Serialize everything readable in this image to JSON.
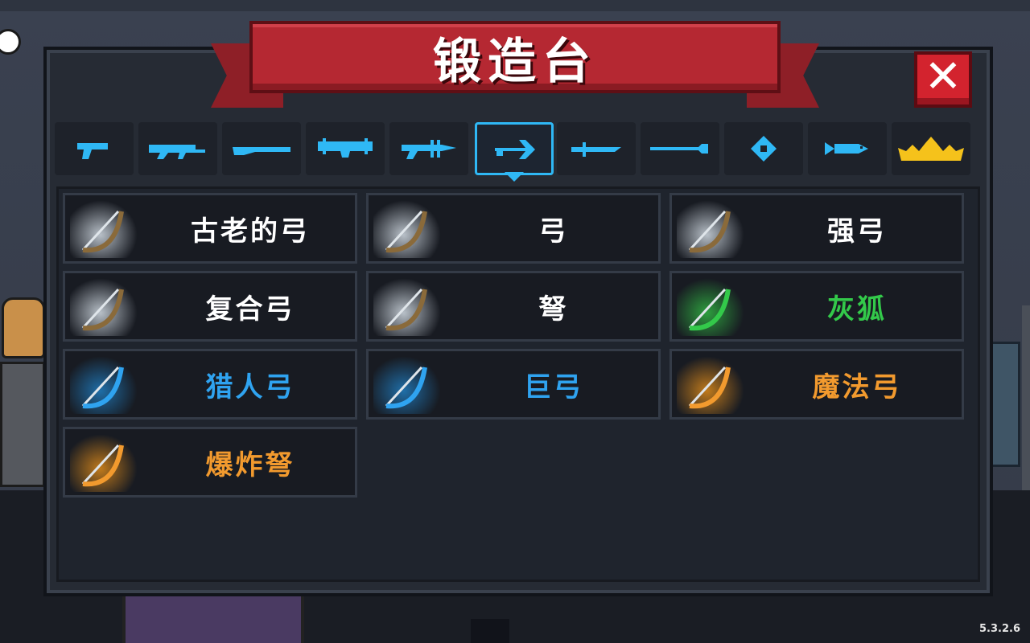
{
  "window": {
    "title": "锻造台",
    "close_symbol": "✕"
  },
  "tabs": [
    {
      "icon": "pistol-icon",
      "active": false
    },
    {
      "icon": "assault-rifle-icon",
      "active": false
    },
    {
      "icon": "shotgun-icon",
      "active": false
    },
    {
      "icon": "rocket-launcher-icon",
      "active": false
    },
    {
      "icon": "laser-gun-icon",
      "active": false
    },
    {
      "icon": "bow-arrow-icon",
      "active": true
    },
    {
      "icon": "sword-icon",
      "active": false
    },
    {
      "icon": "spear-icon",
      "active": false
    },
    {
      "icon": "shuriken-icon",
      "active": false
    },
    {
      "icon": "fish-icon",
      "active": false
    },
    {
      "icon": "crown-icon",
      "active": false
    }
  ],
  "items": [
    {
      "name": "古老的弓",
      "color": "#ffffff",
      "glow": "#b8c0c8"
    },
    {
      "name": "弓",
      "color": "#ffffff",
      "glow": "#b8c0c8"
    },
    {
      "name": "强弓",
      "color": "#ffffff",
      "glow": "#b8c0c8"
    },
    {
      "name": "复合弓",
      "color": "#ffffff",
      "glow": "#b8c0c8"
    },
    {
      "name": "弩",
      "color": "#ffffff",
      "glow": "#b8c0c8"
    },
    {
      "name": "灰狐",
      "color": "#33c94a",
      "glow": "#2d9e3e"
    },
    {
      "name": "猎人弓",
      "color": "#2fa3f0",
      "glow": "#1f6ea8"
    },
    {
      "name": "巨弓",
      "color": "#2fa3f0",
      "glow": "#1f6ea8"
    },
    {
      "name": "魔法弓",
      "color": "#f29a2e",
      "glow": "#c07a1c"
    },
    {
      "name": "爆炸弩",
      "color": "#f29a2e",
      "glow": "#c07a1c"
    }
  ],
  "version": "5.3.2.6",
  "colors": {
    "accent": "#2fb8f5",
    "banner": "#b52832",
    "tab_icon": "#2fb8f5",
    "crown": "#f5c21b"
  }
}
